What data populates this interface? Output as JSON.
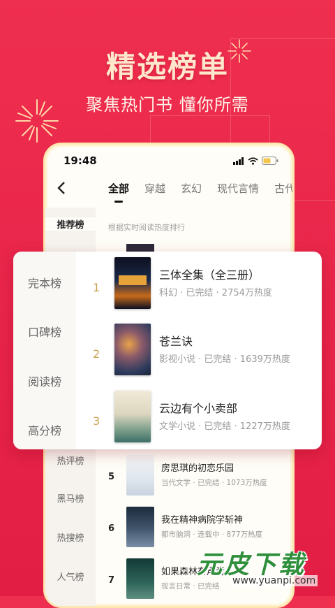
{
  "hero": {
    "title": "精选榜单",
    "subtitle": "聚焦热门书 懂你所需"
  },
  "status": {
    "time": "19:48"
  },
  "tabs": [
    "全部",
    "穿越",
    "玄幻",
    "现代言情",
    "古代"
  ],
  "left_menu": [
    "推荐榜",
    "热评榜",
    "黑马榜",
    "热搜榜",
    "人气榜"
  ],
  "hint": "根据实时阅读热度排行",
  "list": [
    {
      "rank": "5",
      "title": "房思琪的初恋乐园",
      "meta": "当代文学 · 已完结 · 1073万热度"
    },
    {
      "rank": "6",
      "title": "我在精神病院学斩神",
      "meta": "都市脑洞 · 连载中 · 877万热度"
    },
    {
      "rank": "7",
      "title": "如果森林有声音",
      "meta": "现言日常 · 已完结"
    }
  ],
  "popup": {
    "categories": [
      "完本榜",
      "口碑榜",
      "阅读榜",
      "高分榜"
    ],
    "items": [
      {
        "rank": "1",
        "title": "三体全集（全三册）",
        "meta": "科幻 · 已完结 · 2754万热度"
      },
      {
        "rank": "2",
        "title": "苍兰诀",
        "meta": "影视小说 · 已完结 · 1639万热度"
      },
      {
        "rank": "3",
        "title": "云边有个小卖部",
        "meta": "文学小说 · 已完结 · 1227万热度"
      }
    ]
  },
  "watermark": {
    "main": "元皮下载",
    "url": "www.yuanpi.com"
  },
  "colors": {
    "background": "#e8244a",
    "hero_title": "#ffe7cc",
    "rank_gold": "#c7a253"
  }
}
